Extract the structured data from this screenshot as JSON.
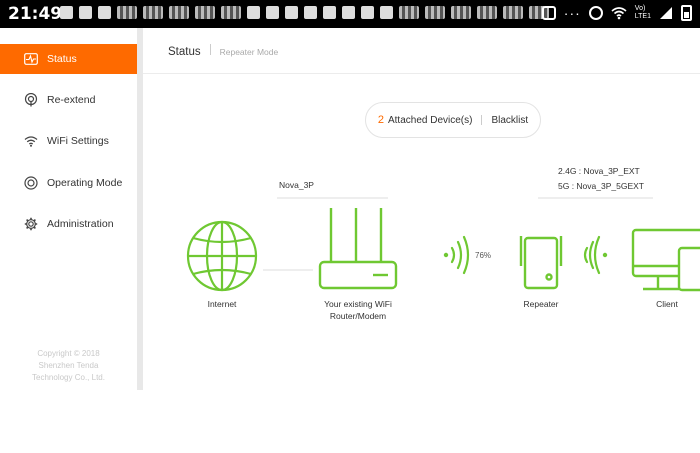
{
  "statusbar": {
    "time": "21:49"
  },
  "sidebar": {
    "items": [
      {
        "label": "Status",
        "icon": "pulse-icon",
        "active": true
      },
      {
        "label": "Re-extend",
        "icon": "signal-icon",
        "active": false
      },
      {
        "label": "WiFi Settings",
        "icon": "wifi-icon",
        "active": false
      },
      {
        "label": "Operating Mode",
        "icon": "mode-icon",
        "active": false
      },
      {
        "label": "Administration",
        "icon": "gear-icon",
        "active": false
      }
    ],
    "copyright": [
      "Copyright © 2018",
      "Shenzhen Tenda",
      "Technology Co., Ltd."
    ]
  },
  "header": {
    "title": "Status",
    "subtitle": "Repeater Mode"
  },
  "devices": {
    "count": "2",
    "label": "Attached Device(s)",
    "blacklist": "Blacklist"
  },
  "topology": {
    "internet": "Internet",
    "router_ssid": "Nova_3P",
    "router_label_1": "Your existing WiFi",
    "router_label_2": "Router/Modem",
    "signal": "76%",
    "repeater_ssid_24": "2.4G : Nova_3P_EXT",
    "repeater_ssid_5": "5G : Nova_3P_5GEXT",
    "repeater": "Repeater",
    "client": "Client"
  },
  "colors": {
    "accent": "#fe6a00",
    "device_green": "#6fc832"
  }
}
